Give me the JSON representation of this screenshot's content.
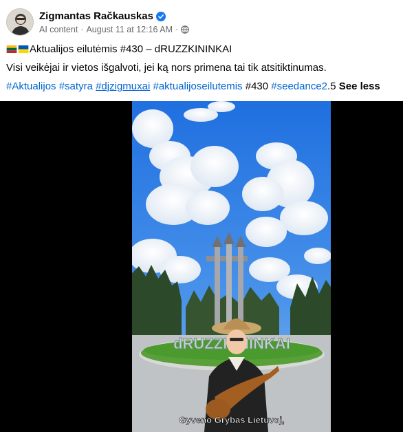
{
  "post": {
    "author": "Zigmantas Račkauskas",
    "verified_icon": "verified-badge-icon",
    "meta_label": "AI content",
    "meta_separator": "·",
    "timestamp": "August 11 at 12:16 AM",
    "privacy_icon": "globe-icon",
    "title_flags": [
      "lithuania-flag-icon",
      "ukraine-flag-icon"
    ],
    "title": "Aktualijos eilutėmis #430 – dRUZZKININKAI",
    "body": "Visi veikėjai ir vietos išgalvoti, jei ką nors primena tai tik atsitiktinumas.",
    "hashtags": [
      {
        "text": "#Aktualijos",
        "style": "link"
      },
      {
        "text": "#satyra",
        "style": "link"
      },
      {
        "text": "#djzigmuxai",
        "style": "link-underline"
      },
      {
        "text": "#aktualijoseilutemis",
        "style": "link"
      },
      {
        "text": "#430",
        "style": "plain"
      },
      {
        "text": "#seedance2",
        "style": "link"
      },
      {
        "text": ".5",
        "style": "plain"
      }
    ],
    "see_less": "See less"
  },
  "video": {
    "sign_text": "dRUZZKININKAI",
    "subtitle": "Gyveno Grybas Lietuvoj,"
  },
  "colors": {
    "link": "#0064d1",
    "meta": "#65676b",
    "verified": "#1877f2",
    "sky": "#2f7fe0",
    "lawn": "#4a9a2e"
  }
}
